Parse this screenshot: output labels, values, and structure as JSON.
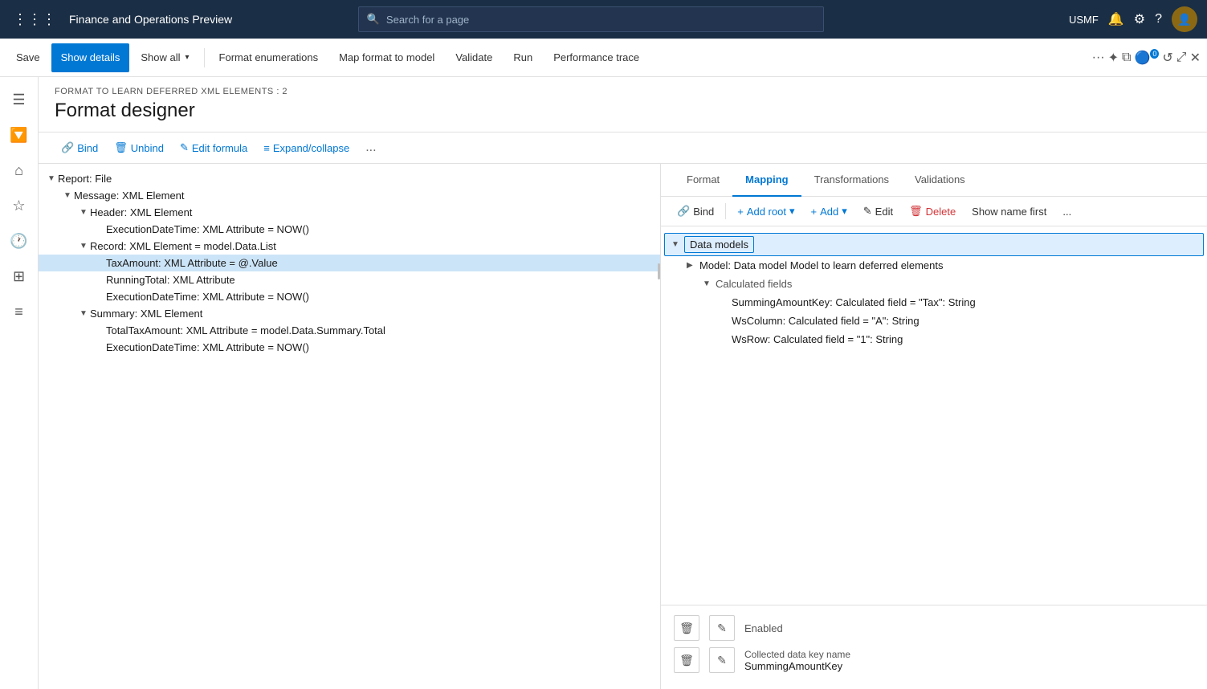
{
  "topNav": {
    "title": "Finance and Operations Preview",
    "searchPlaceholder": "Search for a page",
    "userLabel": "USMF"
  },
  "toolbar": {
    "saveLabel": "Save",
    "showDetailsLabel": "Show details",
    "showAllLabel": "Show all",
    "formatEnumerationsLabel": "Format enumerations",
    "mapFormatToModelLabel": "Map format to model",
    "validateLabel": "Validate",
    "runLabel": "Run",
    "performanceTraceLabel": "Performance trace"
  },
  "page": {
    "subtitle": "FORMAT TO LEARN DEFERRED XML ELEMENTS : 2",
    "title": "Format designer"
  },
  "actionBar": {
    "bindLabel": "Bind",
    "unbindLabel": "Unbind",
    "editFormulaLabel": "Edit formula",
    "expandCollapseLabel": "Expand/collapse",
    "moreLabel": "..."
  },
  "formatTree": {
    "nodes": [
      {
        "id": "report",
        "label": "Report: File",
        "level": 0,
        "expanded": true,
        "arrow": "▼"
      },
      {
        "id": "message",
        "label": "Message: XML Element",
        "level": 1,
        "expanded": true,
        "arrow": "▼"
      },
      {
        "id": "header",
        "label": "Header: XML Element",
        "level": 2,
        "expanded": true,
        "arrow": "▼"
      },
      {
        "id": "execdt1",
        "label": "ExecutionDateTime: XML Attribute = NOW()",
        "level": 3,
        "expanded": false,
        "arrow": ""
      },
      {
        "id": "record",
        "label": "Record: XML Element = model.Data.List",
        "level": 2,
        "expanded": true,
        "arrow": "▼"
      },
      {
        "id": "taxamount",
        "label": "TaxAmount: XML Attribute = @.Value",
        "level": 3,
        "expanded": false,
        "arrow": "",
        "selected": true
      },
      {
        "id": "runningtotal",
        "label": "RunningTotal: XML Attribute",
        "level": 3,
        "expanded": false,
        "arrow": ""
      },
      {
        "id": "execdt2",
        "label": "ExecutionDateTime: XML Attribute = NOW()",
        "level": 3,
        "expanded": false,
        "arrow": ""
      },
      {
        "id": "summary",
        "label": "Summary: XML Element",
        "level": 2,
        "expanded": false,
        "arrow": "▼"
      },
      {
        "id": "totaltax",
        "label": "TotalTaxAmount: XML Attribute = model.Data.Summary.Total",
        "level": 3,
        "expanded": false,
        "arrow": ""
      },
      {
        "id": "execdt3",
        "label": "ExecutionDateTime: XML Attribute = NOW()",
        "level": 3,
        "expanded": false,
        "arrow": ""
      }
    ]
  },
  "tabs": {
    "format": "Format",
    "mapping": "Mapping",
    "transformations": "Transformations",
    "validations": "Validations",
    "activeTab": "Mapping"
  },
  "mappingToolbar": {
    "bindLabel": "Bind",
    "addRootLabel": "Add root",
    "addLabel": "Add",
    "editLabel": "Edit",
    "deleteLabel": "Delete",
    "showNameFirstLabel": "Show name first",
    "moreLabel": "..."
  },
  "dataModel": {
    "rootLabel": "Data models",
    "modelLabel": "Model: Data model Model to learn deferred elements",
    "calculatedFieldsLabel": "Calculated fields",
    "fields": [
      {
        "id": "summing",
        "label": "SummingAmountKey: Calculated field = \"Tax\": String"
      },
      {
        "id": "wscolumn",
        "label": "WsColumn: Calculated field = \"A\": String"
      },
      {
        "id": "wsrow",
        "label": "WsRow: Calculated field = \"1\": String"
      }
    ]
  },
  "bottomPanel": {
    "enabledLabel": "Enabled",
    "collectedKeyLabel": "Collected data key name",
    "collectedKeyValue": "SummingAmountKey",
    "editIcon": "✎",
    "deleteIcon": "🗑"
  },
  "sidebarIcons": [
    {
      "id": "menu",
      "icon": "☰"
    },
    {
      "id": "home",
      "icon": "⌂"
    },
    {
      "id": "star",
      "icon": "☆"
    },
    {
      "id": "clock",
      "icon": "🕐"
    },
    {
      "id": "grid",
      "icon": "⊞"
    },
    {
      "id": "list",
      "icon": "≡"
    }
  ]
}
